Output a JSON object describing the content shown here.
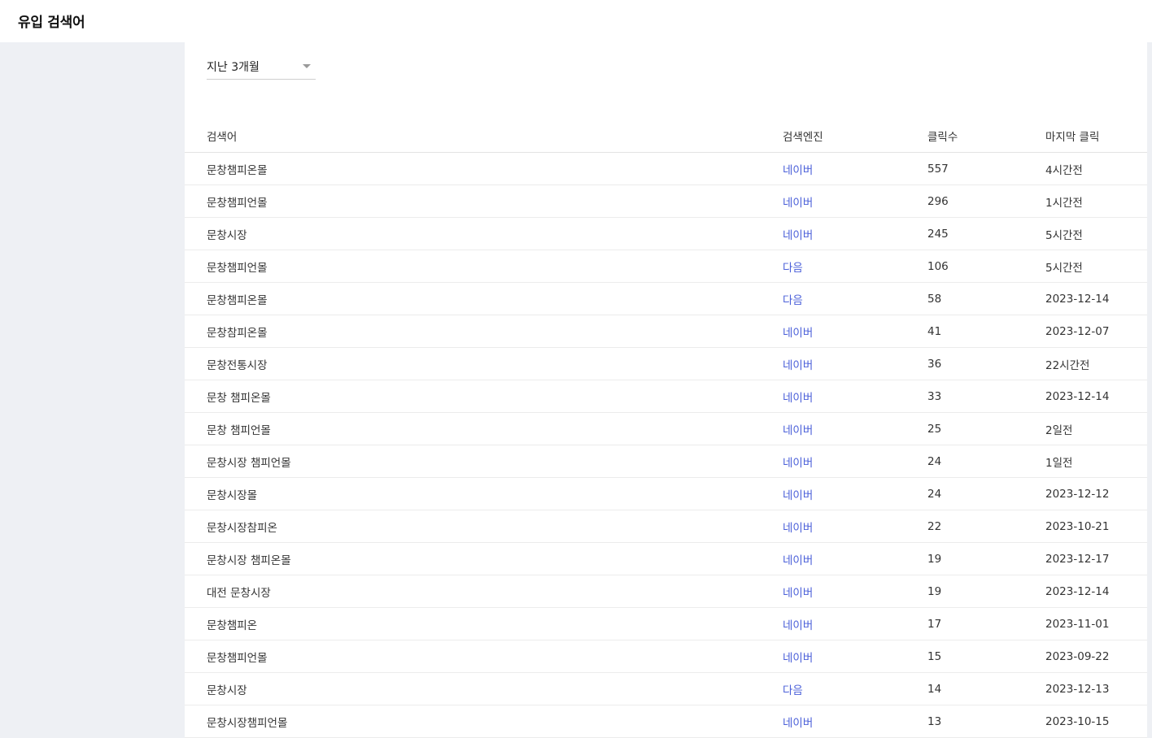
{
  "header": {
    "title": "유입 검색어"
  },
  "filter": {
    "period_label": "지난 3개월"
  },
  "table": {
    "columns": {
      "keyword": "검색어",
      "engine": "검색엔진",
      "clicks": "클릭수",
      "last_click": "마지막 클릭"
    },
    "rows": [
      {
        "keyword": "문창챔피온몰",
        "engine": "네이버",
        "clicks": "557",
        "last_click": "4시간전"
      },
      {
        "keyword": "문창챔피언몰",
        "engine": "네이버",
        "clicks": "296",
        "last_click": "1시간전"
      },
      {
        "keyword": "문창시장",
        "engine": "네이버",
        "clicks": "245",
        "last_click": "5시간전"
      },
      {
        "keyword": "문창챔피언몰",
        "engine": "다음",
        "clicks": "106",
        "last_click": "5시간전"
      },
      {
        "keyword": "문창챔피온몰",
        "engine": "다음",
        "clicks": "58",
        "last_click": "2023-12-14"
      },
      {
        "keyword": "문창참피온몰",
        "engine": "네이버",
        "clicks": "41",
        "last_click": "2023-12-07"
      },
      {
        "keyword": "문창전통시장",
        "engine": "네이버",
        "clicks": "36",
        "last_click": "22시간전"
      },
      {
        "keyword": "문창 챔피온몰",
        "engine": "네이버",
        "clicks": "33",
        "last_click": "2023-12-14"
      },
      {
        "keyword": "문창 챔피언몰",
        "engine": "네이버",
        "clicks": "25",
        "last_click": "2일전"
      },
      {
        "keyword": "문창시장 챔피언몰",
        "engine": "네이버",
        "clicks": "24",
        "last_click": "1일전"
      },
      {
        "keyword": "문창시장몰",
        "engine": "네이버",
        "clicks": "24",
        "last_click": "2023-12-12"
      },
      {
        "keyword": "문창시장참피온",
        "engine": "네이버",
        "clicks": "22",
        "last_click": "2023-10-21"
      },
      {
        "keyword": "문창시장 챔피온몰",
        "engine": "네이버",
        "clicks": "19",
        "last_click": "2023-12-17"
      },
      {
        "keyword": "대전 문창시장",
        "engine": "네이버",
        "clicks": "19",
        "last_click": "2023-12-14"
      },
      {
        "keyword": "문창챔피온",
        "engine": "네이버",
        "clicks": "17",
        "last_click": "2023-11-01"
      },
      {
        "keyword": "문창챔피언몰",
        "engine": "네이버",
        "clicks": "15",
        "last_click": "2023-09-22"
      },
      {
        "keyword": "문창시장",
        "engine": "다음",
        "clicks": "14",
        "last_click": "2023-12-13"
      },
      {
        "keyword": "문창시장챔피언몰",
        "engine": "네이버",
        "clicks": "13",
        "last_click": "2023-10-15"
      }
    ]
  },
  "colors": {
    "sidebar_bg": "#eef0f4",
    "link": "#4a5fd9"
  }
}
